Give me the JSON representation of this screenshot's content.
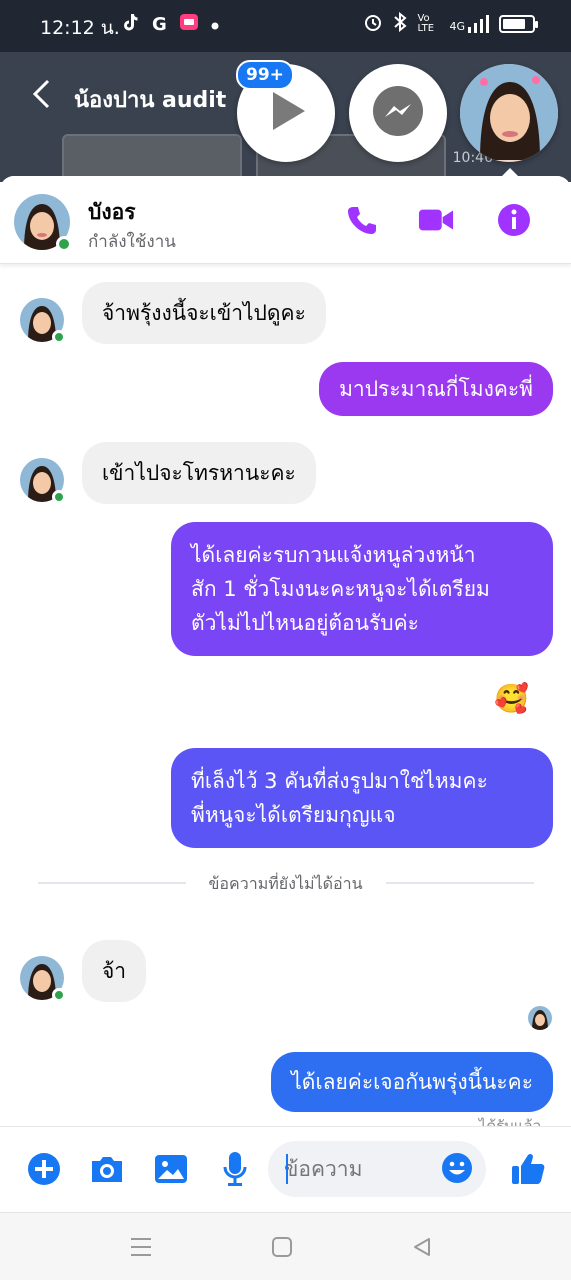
{
  "status_bar": {
    "time": "12:12 น.",
    "network_label": "4G",
    "volte_label": "Vo LTE",
    "battery_level": 0.8
  },
  "background_chat": {
    "title": "น้องปาน audit",
    "time": "10:46"
  },
  "chat_heads": {
    "badge_count": "99+"
  },
  "conversation": {
    "contact_name": "บังอร",
    "contact_status": "กำลังใช้งาน",
    "messages": [
      {
        "direction": "in",
        "text": "จ้าพรุ้งงนี้จะเข้าไปดูคะ"
      },
      {
        "direction": "out",
        "text": "มาประมาณกี่โมงคะพี่"
      },
      {
        "direction": "in",
        "text": "เข้าไปจะโทรหานะคะ"
      },
      {
        "direction": "out",
        "lines": [
          "ได้เลยค่ะรบกวนแจ้งหนูล่วงหน้า",
          "สัก 1 ชั่วโมงนะคะหนูจะได้เตรียม",
          "ตัวไม่ไปไหนอยู่ต้อนรับค่ะ"
        ]
      },
      {
        "direction": "out",
        "lines": [
          "ที่เล็งไว้ 3 คันที่ส่งรูปมาใช่ไหมคะ",
          "พี่หนูจะได้เตรียมกุญแจ"
        ]
      },
      {
        "direction": "in",
        "text": "จ้า"
      },
      {
        "direction": "out",
        "text": "ได้เลยค่ะเจอกันพรุ่งนี้นะคะ"
      }
    ],
    "reaction_emoji": "🥰",
    "unread_divider": "ข้อความที่ยังไม่ได้อ่าน",
    "delivered_label": "ได้รับแล้ว"
  },
  "composer": {
    "placeholder": "ข้อความ"
  },
  "colors": {
    "accent": "#a033ff",
    "bubble_out_1": "#9b39f0",
    "bubble_out_2": "#7a45f5",
    "bubble_out_3": "#5b55f5",
    "bubble_out_4": "#2e6ff2",
    "online": "#31a24c",
    "composer_icons": "#1877f2"
  }
}
